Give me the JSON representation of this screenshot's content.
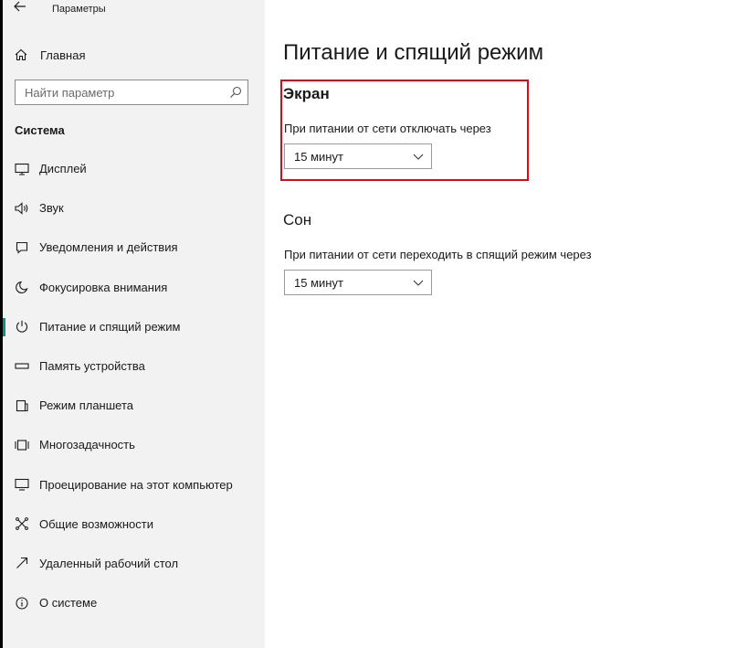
{
  "window": {
    "title": "Параметры"
  },
  "sidebar": {
    "home_label": "Главная",
    "search_placeholder": "Найти параметр",
    "section_title": "Система",
    "items": [
      {
        "label": "Дисплей",
        "icon": "display-icon"
      },
      {
        "label": "Звук",
        "icon": "speaker-icon"
      },
      {
        "label": "Уведомления и действия",
        "icon": "notification-icon"
      },
      {
        "label": "Фокусировка внимания",
        "icon": "moon-icon"
      },
      {
        "label": "Питание и спящий режим",
        "icon": "power-icon",
        "active": true
      },
      {
        "label": "Память устройства",
        "icon": "storage-icon"
      },
      {
        "label": "Режим планшета",
        "icon": "tablet-icon"
      },
      {
        "label": "Многозадачность",
        "icon": "multitasking-icon"
      },
      {
        "label": "Проецирование на этот компьютер",
        "icon": "projecting-icon"
      },
      {
        "label": "Общие возможности",
        "icon": "shared-icon"
      },
      {
        "label": "Удаленный рабочий стол",
        "icon": "remote-desktop-icon"
      },
      {
        "label": "О системе",
        "icon": "info-icon"
      }
    ]
  },
  "main": {
    "page_title": "Питание и спящий режим",
    "screen": {
      "title": "Экран",
      "label": "При питании от сети отключать через",
      "value": "15 минут"
    },
    "sleep": {
      "title": "Сон",
      "label": "При питании от сети переходить в спящий режим через",
      "value": "15 минут"
    }
  },
  "colors": {
    "accent": "#0e8f80",
    "highlight": "#e30613",
    "sidebar_bg": "#f2f2f2"
  }
}
